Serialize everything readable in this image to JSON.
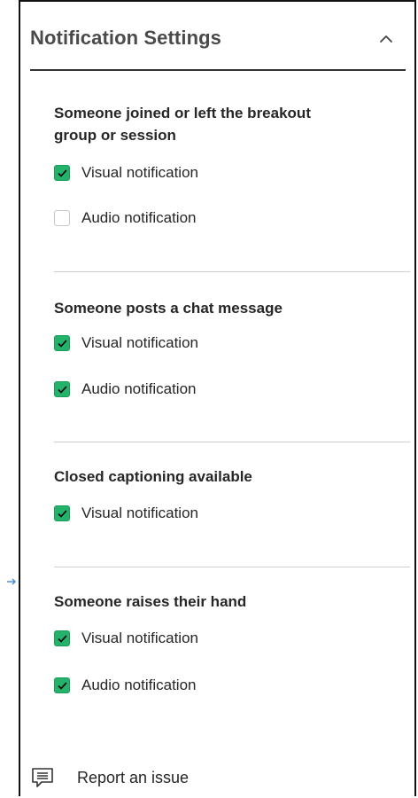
{
  "header": {
    "title": "Notification Settings"
  },
  "sections": [
    {
      "title_line1": "Someone joined or left the breakout",
      "title_line2": "group or session",
      "options": [
        {
          "label": "Visual notification",
          "checked": true
        },
        {
          "label": "Audio notification",
          "checked": false
        }
      ]
    },
    {
      "title_line1": "Someone posts a chat message",
      "options": [
        {
          "label": "Visual notification",
          "checked": true
        },
        {
          "label": "Audio notification",
          "checked": true
        }
      ]
    },
    {
      "title_line1": "Closed captioning available",
      "options": [
        {
          "label": "Visual notification",
          "checked": true
        }
      ]
    },
    {
      "title_line1": "Someone raises their hand",
      "options": [
        {
          "label": "Visual notification",
          "checked": true
        },
        {
          "label": "Audio notification",
          "checked": true
        }
      ]
    }
  ],
  "footer": {
    "report_label": "Report an issue",
    "report_icon": "feedback-message-icon"
  },
  "colors": {
    "checkbox_checked": "#25b36b",
    "checkbox_unchecked_border": "#c8c8c8",
    "text": "#262626",
    "divider": "#cfcfcf"
  }
}
